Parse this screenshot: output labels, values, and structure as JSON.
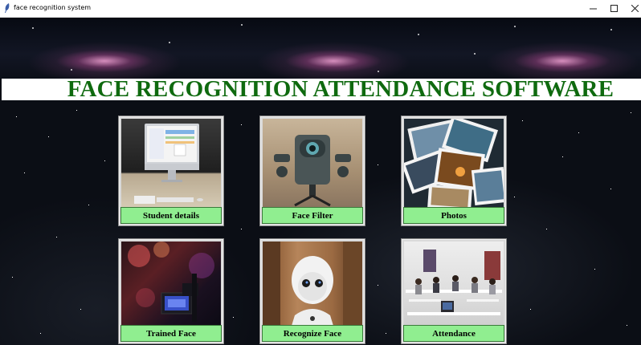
{
  "window": {
    "title": "face recognition system",
    "controls": {
      "minimize": "–",
      "maximize": "□",
      "close": "✕"
    }
  },
  "header": {
    "title": "FACE RECOGNITION ATTENDANCE SOFTWARE",
    "title_color": "#0f6a0f"
  },
  "tiles": [
    {
      "label": "Student details",
      "icon": "imac-desk-photo"
    },
    {
      "label": "Face Filter",
      "icon": "camera-rig-photo"
    },
    {
      "label": "Photos",
      "icon": "scattered-photos"
    },
    {
      "label": "Trained Face",
      "icon": "camera-lights-photo"
    },
    {
      "label": "Recognize Face",
      "icon": "robot-photo"
    },
    {
      "label": "Attendance",
      "icon": "classroom-photo"
    }
  ],
  "colors": {
    "button_bg": "#90ee90",
    "background": "#0a0d14"
  }
}
